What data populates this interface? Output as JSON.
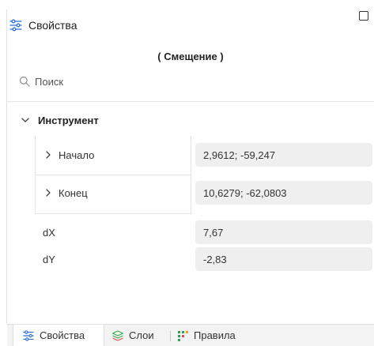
{
  "header": {
    "title": "Свойства",
    "icon": "properties-icon"
  },
  "subtitle": "( Смещение )",
  "search": {
    "placeholder": "Поиск",
    "value": ""
  },
  "group": {
    "label": "Инструмент"
  },
  "rows": [
    {
      "label": "Начало",
      "value": "2,9612; -59,247",
      "expandable": true
    },
    {
      "label": "Конец",
      "value": "10,6279; -62,0803",
      "expandable": true
    },
    {
      "label": "dX",
      "value": "7,67",
      "expandable": false
    },
    {
      "label": "dY",
      "value": "-2,83",
      "expandable": false
    }
  ],
  "tabs": [
    {
      "label": "Свойства",
      "icon": "properties-icon",
      "active": true
    },
    {
      "label": "Слои",
      "icon": "layers-icon",
      "active": false
    },
    {
      "label": "Правила",
      "icon": "rules-grid-icon",
      "active": false
    }
  ],
  "colors": {
    "accent": "#2f6fd6",
    "layers_green": "#3aa655",
    "rules_green": "#2e9e4f",
    "value_bg": "#efefef"
  }
}
